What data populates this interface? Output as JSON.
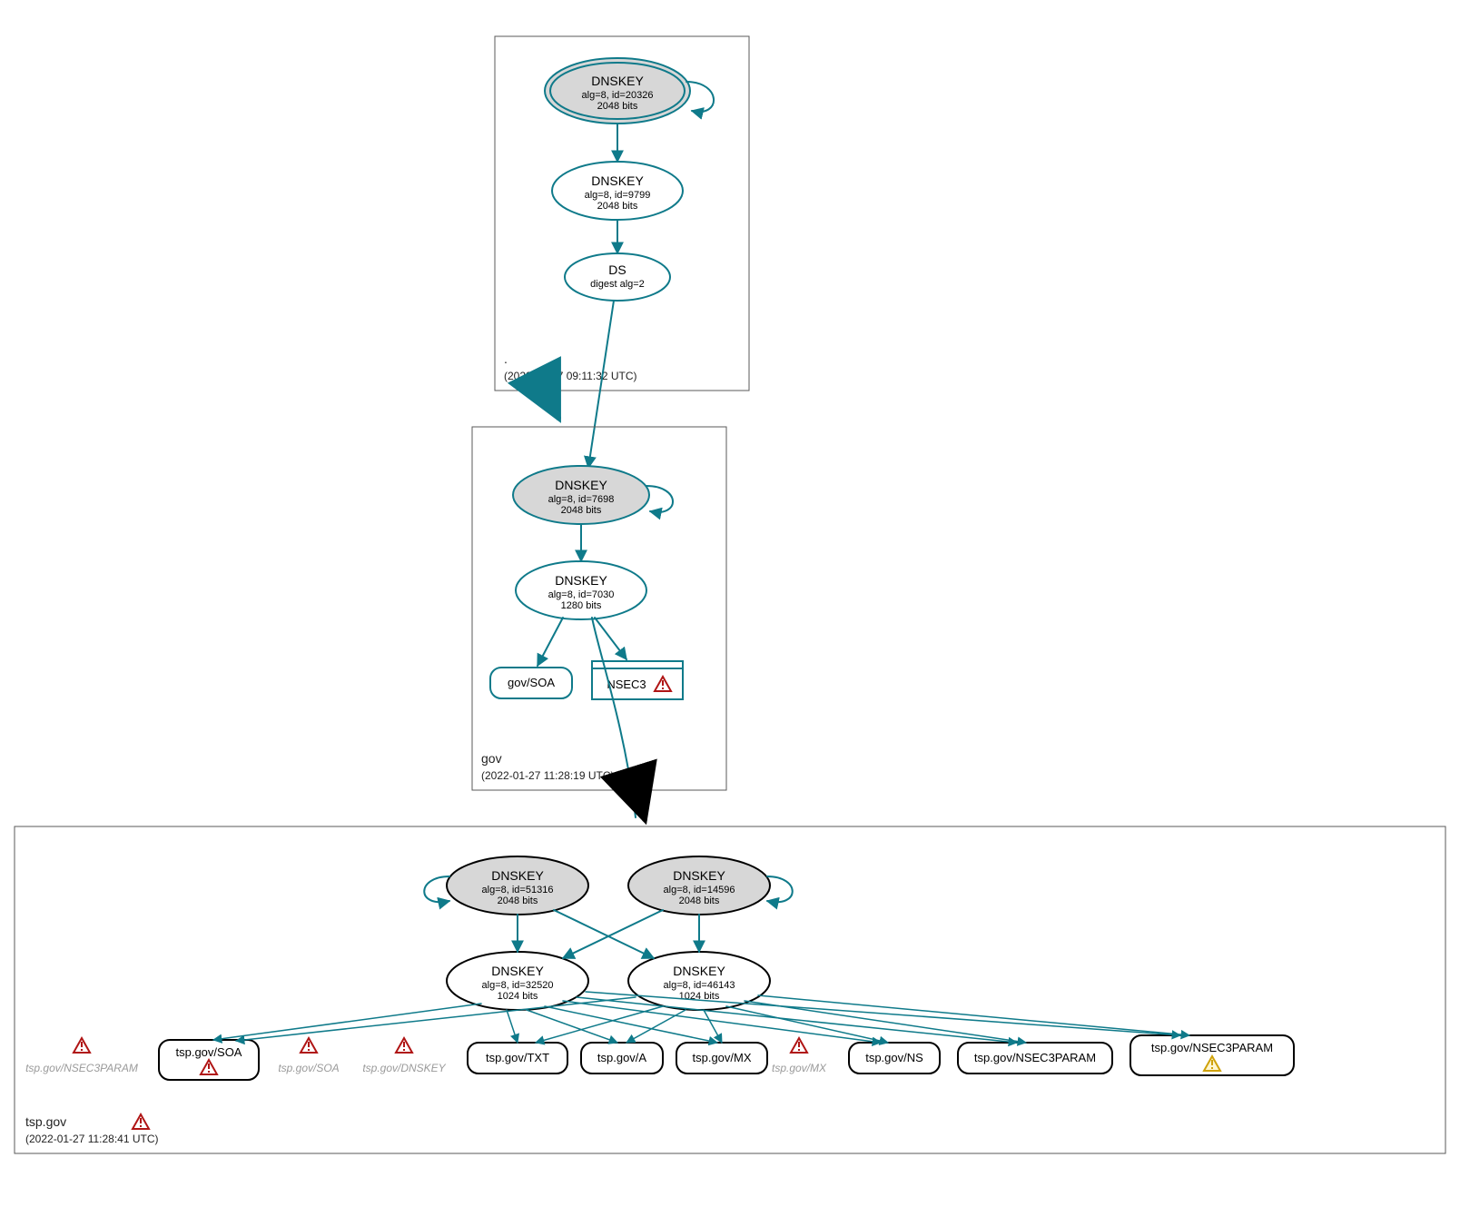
{
  "diagram": {
    "colors": {
      "teal": "#0f7a8a",
      "black": "#000000",
      "kskFill": "#d7d7d7"
    },
    "zones": [
      {
        "id": "root",
        "label": ".",
        "timestamp": "(2022-01-27 09:11:32 UTC)"
      },
      {
        "id": "gov",
        "label": "gov",
        "timestamp": "(2022-01-27 11:28:19 UTC)"
      },
      {
        "id": "tsp",
        "label": "tsp.gov",
        "timestamp": "(2022-01-27 11:28:41 UTC)",
        "warn": true
      }
    ],
    "nodes": {
      "root_ksk": {
        "title": "DNSKEY",
        "sub1": "alg=8, id=20326",
        "sub2": "2048 bits"
      },
      "root_zsk": {
        "title": "DNSKEY",
        "sub1": "alg=8, id=9799",
        "sub2": "2048 bits"
      },
      "root_ds": {
        "title": "DS",
        "sub1": "digest alg=2"
      },
      "gov_ksk": {
        "title": "DNSKEY",
        "sub1": "alg=8, id=7698",
        "sub2": "2048 bits"
      },
      "gov_zsk": {
        "title": "DNSKEY",
        "sub1": "alg=8, id=7030",
        "sub2": "1280 bits"
      },
      "gov_soa": {
        "label": "gov/SOA"
      },
      "gov_nsec3": {
        "label": "NSEC3",
        "warn": true
      },
      "tsp_ksk1": {
        "title": "DNSKEY",
        "sub1": "alg=8, id=51316",
        "sub2": "2048 bits"
      },
      "tsp_ksk2": {
        "title": "DNSKEY",
        "sub1": "alg=8, id=14596",
        "sub2": "2048 bits"
      },
      "tsp_zsk1": {
        "title": "DNSKEY",
        "sub1": "alg=8, id=32520",
        "sub2": "1024 bits"
      },
      "tsp_zsk2": {
        "title": "DNSKEY",
        "sub1": "alg=8, id=46143",
        "sub2": "1024 bits"
      },
      "tsp_leaf_ghost_nsec3param": {
        "label": "tsp.gov/NSEC3PARAM"
      },
      "tsp_leaf_soa": {
        "label": "tsp.gov/SOA",
        "warn": true
      },
      "tsp_leaf_ghost_soa": {
        "label": "tsp.gov/SOA"
      },
      "tsp_leaf_ghost_dnskey": {
        "label": "tsp.gov/DNSKEY"
      },
      "tsp_leaf_txt": {
        "label": "tsp.gov/TXT"
      },
      "tsp_leaf_a": {
        "label": "tsp.gov/A"
      },
      "tsp_leaf_mx": {
        "label": "tsp.gov/MX"
      },
      "tsp_leaf_ghost_mx": {
        "label": "tsp.gov/MX"
      },
      "tsp_leaf_ns": {
        "label": "tsp.gov/NS"
      },
      "tsp_leaf_nsec3param1": {
        "label": "tsp.gov/NSEC3PARAM"
      },
      "tsp_leaf_nsec3param2": {
        "label": "tsp.gov/NSEC3PARAM",
        "warnYellow": true
      }
    }
  }
}
